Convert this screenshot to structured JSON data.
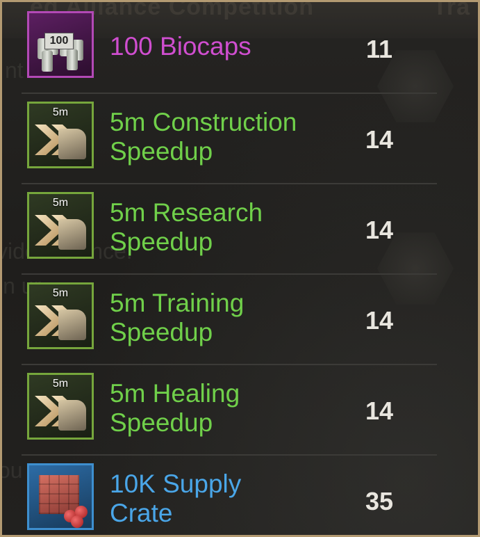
{
  "background": {
    "header_left": "ed Alliance Competition",
    "header_right": "Tra",
    "ghost_texts": [
      "nt",
      "vided is once.",
      "in ur",
      "ou ur"
    ]
  },
  "rewards": [
    {
      "name": "100 Biocaps",
      "quantity": "11",
      "icon": "biocaps-icon",
      "icon_label": "100",
      "rarity": "epic",
      "color": "#cf4ecf"
    },
    {
      "name": "5m Construction Speedup",
      "line1": "5m Construction",
      "line2": "Speedup",
      "quantity": "14",
      "icon": "construction-speedup-icon",
      "badge": "5m",
      "rarity": "uncommon",
      "color": "#70d04a"
    },
    {
      "name": "5m Research Speedup",
      "line1": "5m Research",
      "line2": "Speedup",
      "quantity": "14",
      "icon": "research-speedup-icon",
      "badge": "5m",
      "rarity": "uncommon",
      "color": "#70d04a"
    },
    {
      "name": "5m Training Speedup",
      "line1": "5m Training",
      "line2": "Speedup",
      "quantity": "14",
      "icon": "training-speedup-icon",
      "badge": "5m",
      "rarity": "uncommon",
      "color": "#70d04a"
    },
    {
      "name": "5m Healing Speedup",
      "line1": "5m Healing",
      "line2": "Speedup",
      "quantity": "14",
      "icon": "healing-speedup-icon",
      "badge": "5m",
      "rarity": "uncommon",
      "color": "#70d04a"
    },
    {
      "name": "10K Supply Crate",
      "line1": "10K Supply",
      "line2": "Crate",
      "quantity": "35",
      "icon": "supply-crate-icon",
      "rarity": "rare",
      "color": "#4aa6e8"
    }
  ],
  "colors": {
    "frame_border": "#b39a72",
    "epic": "#b349b6",
    "uncommon": "#76a63c",
    "rare": "#3e8fcf"
  }
}
